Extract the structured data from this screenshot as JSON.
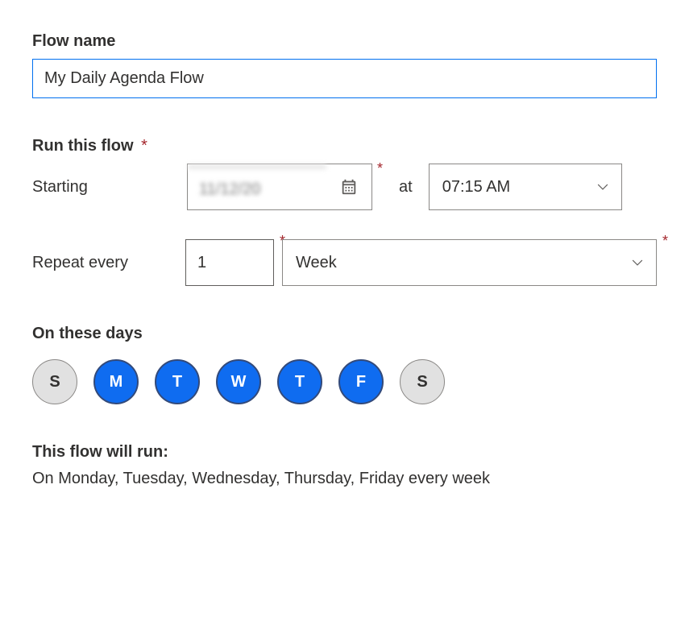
{
  "flowName": {
    "label": "Flow name",
    "value": "My Daily Agenda Flow"
  },
  "runSection": {
    "label": "Run this flow",
    "startingLabel": "Starting",
    "dateValue": "11/12/20",
    "atLabel": "at",
    "timeValue": "07:15 AM",
    "repeatLabel": "Repeat every",
    "repeatNumber": "1",
    "repeatUnit": "Week"
  },
  "daysSection": {
    "label": "On these days",
    "days": [
      {
        "label": "S",
        "selected": false
      },
      {
        "label": "M",
        "selected": true
      },
      {
        "label": "T",
        "selected": true
      },
      {
        "label": "W",
        "selected": true
      },
      {
        "label": "T",
        "selected": true
      },
      {
        "label": "F",
        "selected": true
      },
      {
        "label": "S",
        "selected": false
      }
    ]
  },
  "summary": {
    "label": "This flow will run:",
    "text": "On Monday, Tuesday, Wednesday, Thursday, Friday every week"
  },
  "asterisk": "*"
}
